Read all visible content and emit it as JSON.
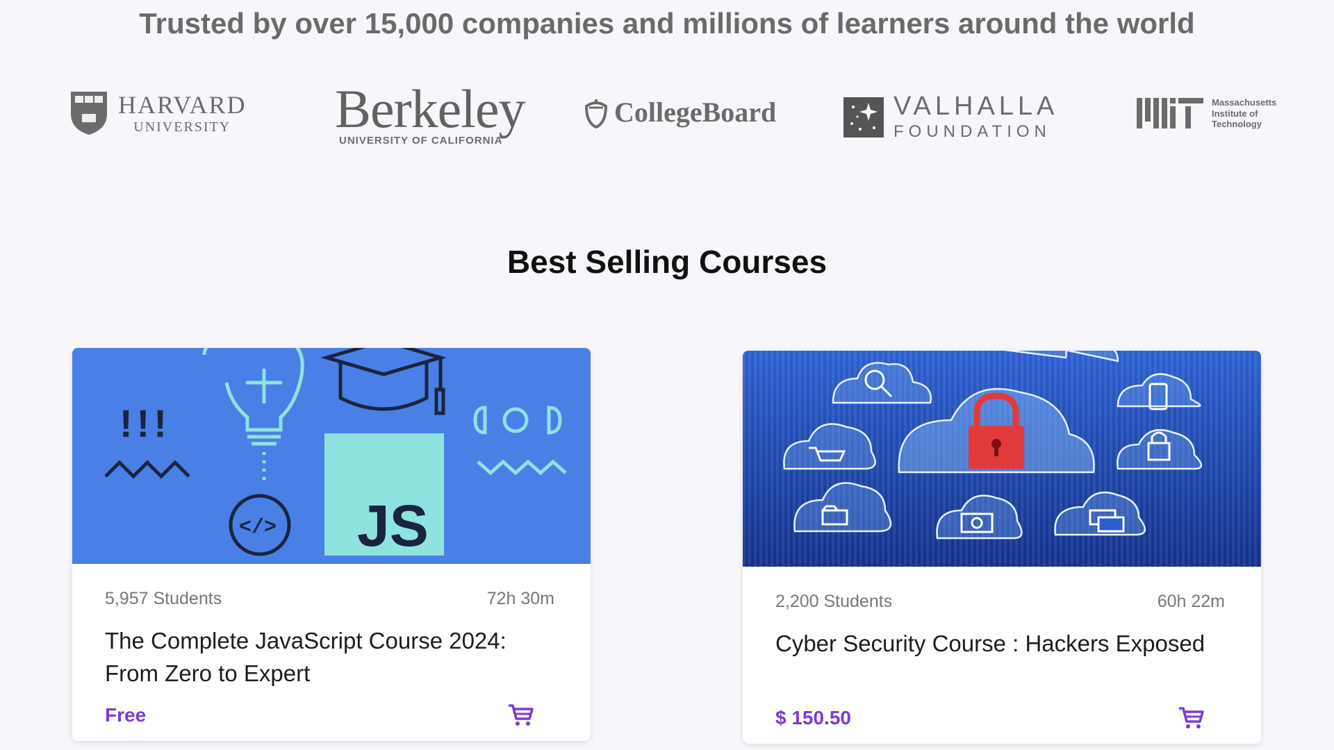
{
  "header": {
    "trusted_text": "Trusted by over 15,000 companies and millions of learners around the world"
  },
  "logos": {
    "harvard": {
      "name": "HARVARD",
      "sub": "UNIVERSITY"
    },
    "berkeley": {
      "name": "Berkeley",
      "sub": "UNIVERSITY OF CALIFORNIA"
    },
    "collegeboard": {
      "name": "CollegeBoard"
    },
    "valhalla": {
      "name": "VALHALLA",
      "sub": "FOUNDATION"
    },
    "mit": {
      "line1": "Massachusetts",
      "line2": "Institute of",
      "line3": "Technology"
    }
  },
  "section": {
    "title": "Best Selling Courses"
  },
  "courses": [
    {
      "students": "5,957 Students",
      "duration": "72h 30m",
      "title": "The Complete JavaScript Course 2024: From Zero to Expert",
      "price": "Free",
      "image_text": "JS",
      "image_marks": "!!!"
    },
    {
      "students": "2,200 Students",
      "duration": "60h 22m",
      "title": "Cyber Security Course : Hackers Exposed",
      "price": "$ 150.50"
    }
  ],
  "colors": {
    "accent": "#7b3ad6",
    "js_bg": "#4a7fe6",
    "js_tile": "#8ee3df",
    "cyber_bg": "#1c3fa8"
  },
  "icons": [
    "shield-icon",
    "acorn-icon",
    "star-field-icon",
    "mit-logo-icon",
    "cart-icon",
    "lightbulb-icon",
    "graduation-cap-icon",
    "lock-icon"
  ]
}
